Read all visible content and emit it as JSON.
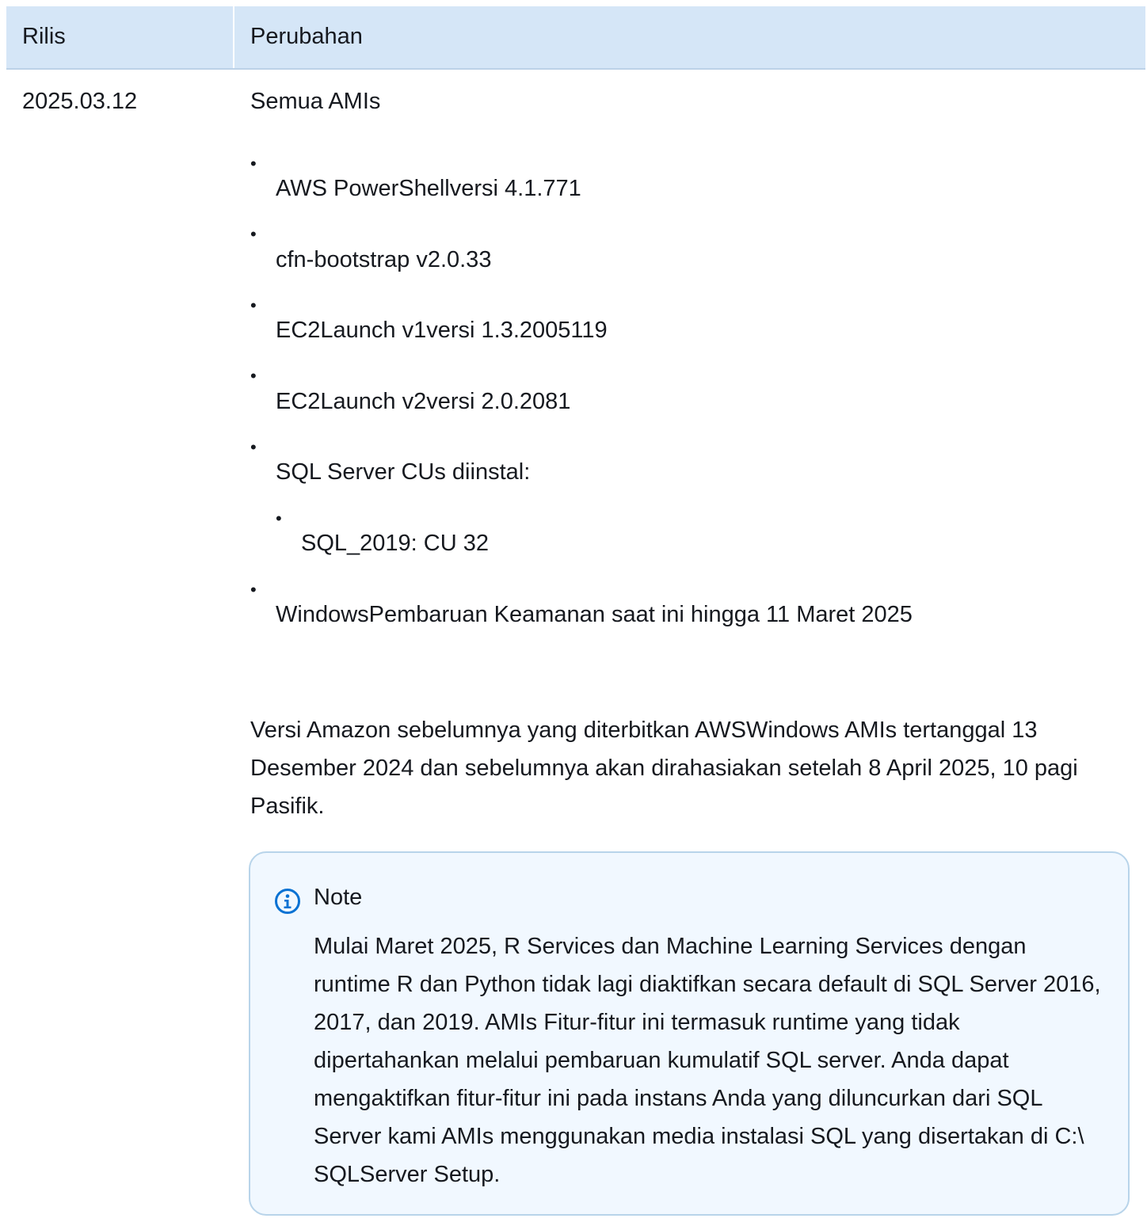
{
  "table": {
    "headers": {
      "release": "Rilis",
      "changes": "Perubahan"
    },
    "row": {
      "release": "2025.03.12",
      "section_title": "Semua AMIs",
      "items": [
        "AWS PowerShellversi 4.1.771",
        "cfn-bootstrap v2.0.33",
        "EC2Launch v1versi 1.3.2005119",
        "EC2Launch v2versi 2.0.2081",
        "SQL Server CUs diinstal:",
        "WindowsPembaruan Keamanan saat ini hingga 11 Maret 2025"
      ],
      "sub_items": [
        "SQL_2019: CU 32"
      ],
      "paragraph": "Versi Amazon sebelumnya yang diterbitkan AWSWindows AMIs tertanggal 13 Desember 2024 dan sebelumnya akan dirahasiakan setelah 8 April 2025, 10 pagi Pasifik.",
      "note": {
        "icon": "info-icon",
        "title": "Note",
        "body": "Mulai Maret 2025, R Services dan Machine Learning Services dengan runtime R dan Python tidak lagi diaktifkan secara default di SQL Server 2016, 2017, dan 2019. AMIs Fitur-fitur ini termasuk runtime yang tidak dipertahankan melalui pembaruan kumulatif SQL server. Anda dapat mengaktifkan fitur-fitur ini pada instans Anda yang diluncurkan dari SQL Server kami AMIs menggunakan media instalasi SQL yang disertakan di C:\\ SQLServer Setup."
      }
    }
  },
  "colors": {
    "header_background": "#d5e6f7",
    "note_background": "#f1f8ff",
    "note_border": "#b8d4ea",
    "info_icon": "#0972d3",
    "text": "#16191f"
  }
}
